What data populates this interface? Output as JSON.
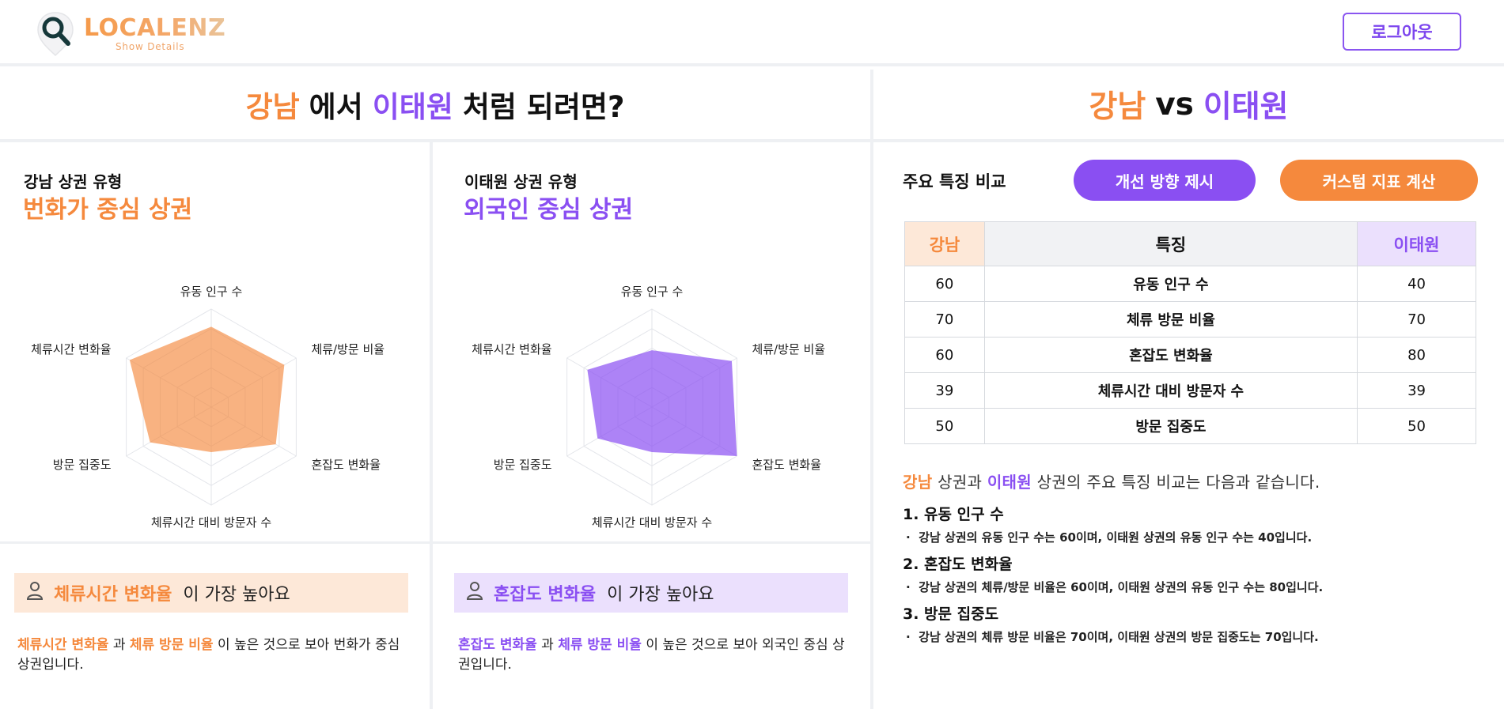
{
  "header": {
    "logo_name": "LOCALENZ",
    "logo_sub": "Show Details",
    "logout_label": "로그아웃"
  },
  "colors": {
    "area_a": "#f5893d",
    "area_b": "#8a4ff2"
  },
  "left_title": {
    "area_a": "강남",
    "mid": "에서",
    "area_b": "이태원",
    "tail": "처럼 되려면?"
  },
  "right_title": {
    "area_a": "강남",
    "mid": "vs",
    "area_b": "이태원"
  },
  "panels": [
    {
      "type_label": "강남 상권 유형",
      "type_value": "번화가 중심 상권",
      "axes": [
        "유동 인구 수",
        "체류/방문 비율",
        "혼잡도 변화율",
        "체류시간 대비 방문자 수",
        "방문 집중도",
        "체류시간 변화율"
      ],
      "values": [
        0.82,
        0.86,
        0.76,
        0.46,
        0.72,
        0.96
      ],
      "highlight_keyword": "체류시간 변화율",
      "highlight_tail": "이 가장 높아요",
      "desc_kw1": "체류시간 변화율",
      "desc_and": "과",
      "desc_kw2": "체류 방문 비율",
      "desc_tail": "이 높은 것으로 보아 번화가 중심 상권입니다."
    },
    {
      "type_label": "이태원 상권 유형",
      "type_value": "외국인 중심 상권",
      "axes": [
        "유동 인구 수",
        "체류/방문 비율",
        "혼잡도 변화율",
        "체류시간 대비 방문자 수",
        "방문 집중도",
        "체류시간 변화율"
      ],
      "values": [
        0.58,
        0.94,
        1.0,
        0.46,
        0.64,
        0.76
      ],
      "highlight_keyword": "혼잡도 변화율",
      "highlight_tail": "이 가장 높아요",
      "desc_kw1": "혼잡도 변화율",
      "desc_and": "과",
      "desc_kw2": "체류 방문 비율",
      "desc_tail": "이 높은 것으로 보아 외국인 중심 상권입니다."
    }
  ],
  "comparison": {
    "label": "주요 특징 비교",
    "btn_improve": "개선 방향 제시",
    "btn_custom": "커스텀 지표 계산",
    "headers": [
      "강남",
      "특징",
      "이태원"
    ],
    "rows": [
      {
        "a": "60",
        "feature": "유동 인구 수",
        "b": "40"
      },
      {
        "a": "70",
        "feature": "체류 방문 비율",
        "b": "70"
      },
      {
        "a": "60",
        "feature": "혼잡도 변화율",
        "b": "80"
      },
      {
        "a": "39",
        "feature": "체류시간 대비 방문자 수",
        "b": "39"
      },
      {
        "a": "50",
        "feature": "방문 집중도",
        "b": "50"
      }
    ],
    "summary_a": "강남",
    "summary_mid": "상권과",
    "summary_b": "이태원",
    "summary_tail": "상권의 주요 특징 비교는 다음과 같습니다.",
    "points": [
      {
        "title": "1. 유동 인구 수",
        "body": "강남 상권의 유동 인구 수는 60이며, 이태원 상권의 유동 인구 수는 40입니다."
      },
      {
        "title": "2. 혼잡도 변화율",
        "body": "강남 상권의 체류/방문 비율은 60이며, 이태원 상권의 유동 인구 수는 80입니다."
      },
      {
        "title": "3. 방문 집중도",
        "body": "강남 상권의 체류 방문 비율은 70이며, 이태원 상권의 방문 집중도는 70입니다."
      }
    ]
  }
}
